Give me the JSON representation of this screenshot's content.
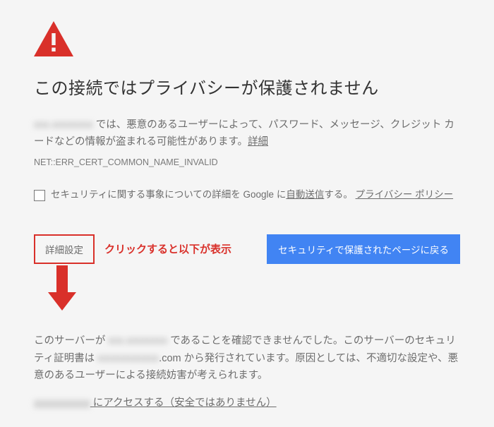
{
  "heading": "この接続ではプライバシーが保護されません",
  "description": {
    "redacted_domain": "xxx.xxxxxxxx",
    "text_after_domain": " では、悪意のあるユーザーによって、パスワード、メッセージ、クレジット カードなどの情報が盗まれる可能性があります。",
    "more_label": "詳細"
  },
  "error_code": "NET::ERR_CERT_COMMON_NAME_INVALID",
  "optin": {
    "pre": "セキュリティに関する事象についての詳細を Google に",
    "auto_send": "自動送信",
    "post": "する。",
    "privacy": "プライバシー ポリシー"
  },
  "advanced_button": "詳細設定",
  "annotation": "クリックすると以下が表示",
  "primary_button": "セキュリティで保護されたページに戻る",
  "details": {
    "l1a": "このサーバーが ",
    "l1_redacted": "xxx.xxxxxxxx",
    "l1b": " であることを確認できませんでした。このサーバーのセキュリティ証明書は ",
    "l1_redacted2": "xxxxxxxxxxxx",
    "l1c": ".com から発行されています。原因としては、不適切な設定や、悪意のあるユーザーによる接続妨害が考えられます。"
  },
  "proceed": {
    "redacted": "xxxxxxxxxxx",
    "label": " にアクセスする（安全ではありません）"
  },
  "icons": {
    "warning": "warning-triangle",
    "arrow": "down-arrow"
  },
  "colors": {
    "danger": "#d9302a",
    "primary": "#4184f3"
  }
}
